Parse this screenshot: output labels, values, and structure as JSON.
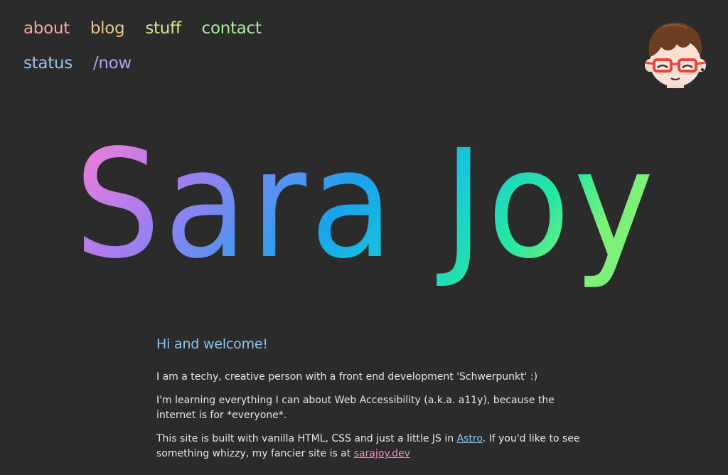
{
  "nav": {
    "row1": [
      {
        "label": "about",
        "color": "#f3a9a0"
      },
      {
        "label": "blog",
        "color": "#e9c48e"
      },
      {
        "label": "stuff",
        "color": "#dde48d"
      },
      {
        "label": "contact",
        "color": "#a9e89f"
      }
    ],
    "row2": [
      {
        "label": "status",
        "color": "#96c4ee"
      },
      {
        "label": "/now",
        "color": "#b9a0f2"
      }
    ]
  },
  "avatar": {
    "icon": "cartoon-face-with-red-glasses-icon"
  },
  "hero": {
    "title": "Sara Joy",
    "gradient": [
      "#ff7fd0",
      "#a67cf0",
      "#1aa3ee",
      "#16c8d8",
      "#27e8a0",
      "#7ef07a"
    ]
  },
  "intro": {
    "heading": "Hi and welcome!",
    "p1": "I am a techy, creative person with a front end development 'Schwerpunkt' :)",
    "p2": "I'm learning everything I can about Web Accessibility (a.k.a. a11y), because the internet is for *everyone*.",
    "p3_before": "This site is built with vanilla HTML, CSS and just a little JS in ",
    "p3_link": "Astro",
    "p3_middle": ". If you'd like to see something whizzy, my fancier site is at ",
    "p3_link2": "sarajoy.dev"
  }
}
